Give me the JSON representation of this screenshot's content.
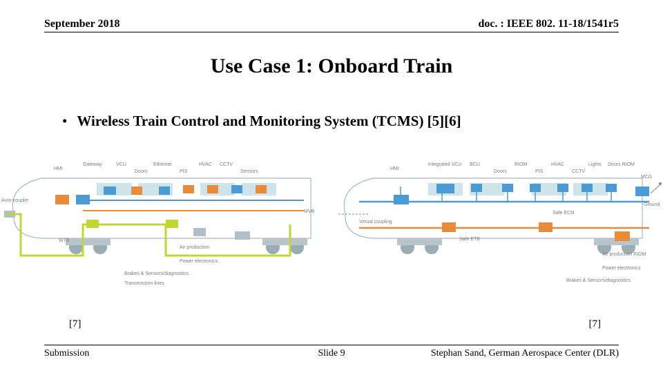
{
  "header": {
    "date": "September 2018",
    "doc": "doc. : IEEE 802. 11-18/1541r5"
  },
  "title": "Use Case 1: Onboard Train",
  "bullet": {
    "text": "Wireless Train Control and Monitoring System (TCMS) [5][6]"
  },
  "figures": {
    "left": {
      "caption": "[7]",
      "labels": {
        "hmi": "HMI",
        "gateway": "Gateway",
        "vcu": "VCU",
        "doors": "Doors",
        "ethernet": "Ethernet",
        "pis": "PIS",
        "hvac": "HVAC",
        "cctv": "CCTV",
        "sensors": "Sensors",
        "autocoupler": "Auto-coupler",
        "mvb": "MVB",
        "wtb": "WTB",
        "airprod": "Air production",
        "power": "Power electronics",
        "brakes": "Brakes & Sensors/diagnostics",
        "transmission": "Transmission lines"
      }
    },
    "right": {
      "caption": "[7]",
      "labels": {
        "hmi": "HMI",
        "ivcu": "Integrated VCU",
        "bcu": "BCU",
        "doors": "Doors",
        "riom": "RIOM",
        "pis": "PIS",
        "hvac": "HVAC",
        "cctv": "CCTV",
        "lights": "Lights",
        "doorsriom": "Doors RIOM",
        "mcg": "MCG",
        "ground": "Ground",
        "virtual": "Virtual coupling",
        "safeetb": "Safe ETB",
        "safeecn": "Safe ECN",
        "airprod": "Air production RIOM",
        "power": "Power electronics",
        "brakes": "Brakes & Sensors/diagnostics"
      }
    }
  },
  "footer": {
    "left": "Submission",
    "center": "Slide 9",
    "right": "Stephan Sand, German Aerospace Center (DLR)"
  }
}
